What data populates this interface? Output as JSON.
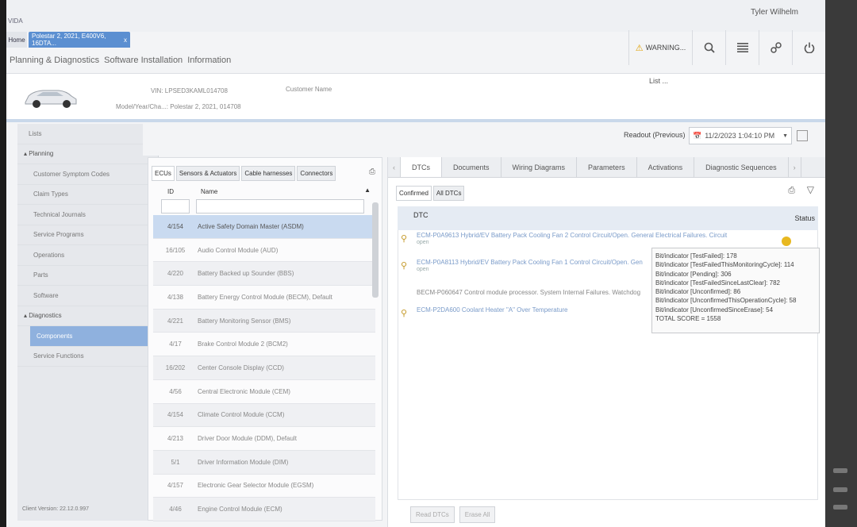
{
  "header": {
    "user": "Tyler Wilhelm",
    "app_logo": "VIDA",
    "home_tab": "Home",
    "vehicle_tab": "Polestar 2, 2021, E400V6, 16DTA...",
    "warning_label": "WARNING...",
    "nav": [
      "Planning & Diagnostics",
      "Software Installation",
      "Information"
    ]
  },
  "vehicle": {
    "vin": "VIN: LPSED3KAML014708",
    "model_year": "Model/Year/Cha...: Polestar 2, 2021, 014708",
    "customer_name": "Customer Name",
    "list": "List ..."
  },
  "sidebar": {
    "items": [
      {
        "label": "Lists",
        "kind": "item"
      },
      {
        "label": "▴ Planning",
        "kind": "section"
      },
      {
        "label": "Customer Symptom Codes",
        "kind": "sub"
      },
      {
        "label": "Claim Types",
        "kind": "sub"
      },
      {
        "label": "Technical Journals",
        "kind": "sub"
      },
      {
        "label": "Service Programs",
        "kind": "sub"
      },
      {
        "label": "Operations",
        "kind": "sub"
      },
      {
        "label": "Parts",
        "kind": "sub"
      },
      {
        "label": "Software",
        "kind": "sub"
      },
      {
        "label": "▴ Diagnostics",
        "kind": "section"
      },
      {
        "label": "Components",
        "kind": "active"
      },
      {
        "label": "Service Functions",
        "kind": "sub"
      }
    ],
    "client_version": "Client Version: 22.12.0.997"
  },
  "readout": {
    "label": "Readout (Previous)",
    "value": "11/2/2023 1:04:10 PM"
  },
  "components": {
    "tabs": [
      "ECUs",
      "Sensors & Actuators",
      "Cable harnesses",
      "Connectors"
    ],
    "col_id": "ID",
    "col_name": "Name",
    "rows": [
      {
        "id": "4/154",
        "name": "Active Safety Domain Master (ASDM)",
        "selected": true
      },
      {
        "id": "16/105",
        "name": "Audio Control Module (AUD)",
        "selected": false
      },
      {
        "id": "4/220",
        "name": "Battery Backed up Sounder (BBS)",
        "selected": false
      },
      {
        "id": "4/138",
        "name": "Battery Energy Control Module (BECM), Default",
        "selected": false
      },
      {
        "id": "4/221",
        "name": "Battery Monitoring Sensor (BMS)",
        "selected": false
      },
      {
        "id": "4/17",
        "name": "Brake Control Module 2 (BCM2)",
        "selected": false
      },
      {
        "id": "16/202",
        "name": "Center Console Display (CCD)",
        "selected": false
      },
      {
        "id": "4/56",
        "name": "Central Electronic Module (CEM)",
        "selected": false
      },
      {
        "id": "4/154",
        "name": "Climate Control Module (CCM)",
        "selected": false
      },
      {
        "id": "4/213",
        "name": "Driver Door Module (DDM), Default",
        "selected": false
      },
      {
        "id": "5/1",
        "name": "Driver Information Module (DIM)",
        "selected": false
      },
      {
        "id": "4/157",
        "name": "Electronic Gear Selector Module (EGSM)",
        "selected": false
      },
      {
        "id": "4/46",
        "name": "Engine Control Module (ECM)",
        "selected": false
      }
    ]
  },
  "dtc_panel": {
    "tabs": [
      "DTCs",
      "Documents",
      "Wiring Diagrams",
      "Parameters",
      "Activations",
      "Diagnostic Sequences"
    ],
    "subtabs": [
      "Confirmed",
      "All DTCs"
    ],
    "col_dtc": "DTC",
    "col_status": "Status",
    "rows": [
      {
        "text": "ECM-P0A9613 Hybrid/EV Battery Pack Cooling Fan 2 Control Circuit/Open. General Electrical Failures. Circuit",
        "sub": "open"
      },
      {
        "text": "ECM-P0A8113 Hybrid/EV Battery Pack Cooling Fan 1 Control Circuit/Open. Gen",
        "sub": "open"
      },
      {
        "text": "BECM-P060647 Control module processor. System Internal Failures. Watchdog",
        "sub": ""
      },
      {
        "text": "ECM-P2DA600 Coolant Heater \"A\" Over Temperature",
        "sub": ""
      }
    ],
    "tooltip": [
      "Bit/indicator [TestFailed]: 178",
      "Bit/indicator [TestFailedThisMonitoringCycle]: 114",
      "Bit/indicator [Pending]: 306",
      "Bit/indicator [TestFailedSinceLastClear]: 782",
      "Bit/indicator [Unconfirmed]: 86",
      "Bit/indicator [UnconfirmedThisOperationCycle]: 58",
      "Bit/indicator [UnconfirmedSinceErase]: 54",
      "TOTAL SCORE = 1558"
    ],
    "buttons": [
      "Read DTCs",
      "Erase All"
    ]
  }
}
